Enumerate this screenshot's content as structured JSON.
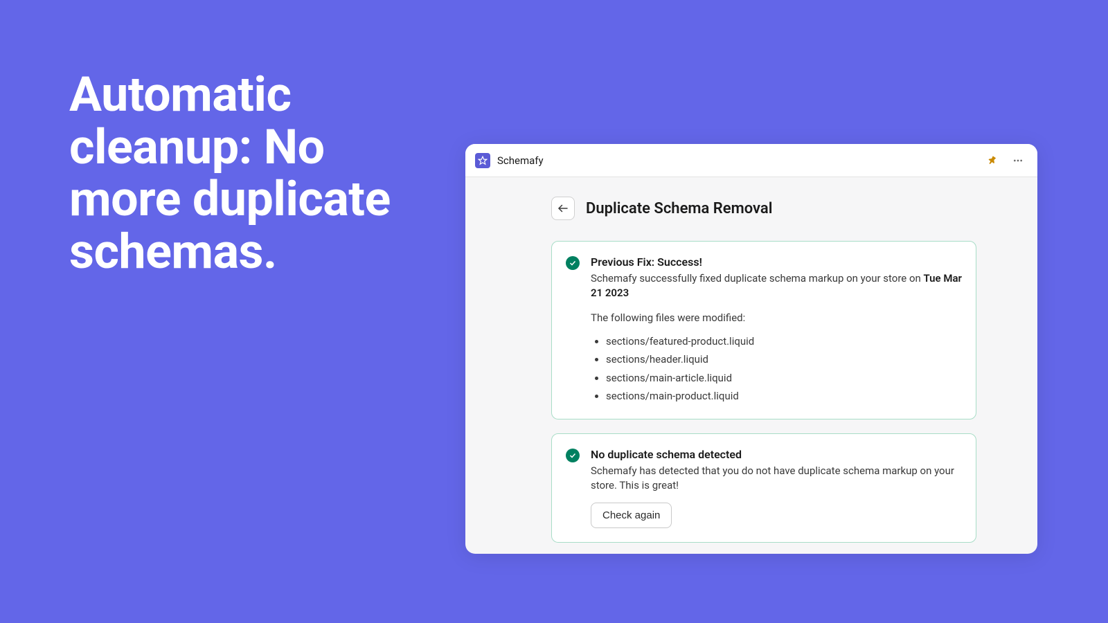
{
  "hero": {
    "headline": "Automatic cleanup: No more duplicate schemas."
  },
  "app": {
    "name": "Schemafy",
    "page_title": "Duplicate Schema Removal",
    "success_card": {
      "title": "Previous Fix: Success!",
      "desc_prefix": "Schemafy successfully fixed duplicate schema markup on your store on ",
      "desc_date": "Tue Mar 21 2023",
      "files_label": "The following files were modified:",
      "files": [
        "sections/featured-product.liquid",
        "sections/header.liquid",
        "sections/main-article.liquid",
        "sections/main-product.liquid"
      ]
    },
    "clean_card": {
      "title": "No duplicate schema detected",
      "desc": "Schemafy has detected that you do not have duplicate schema markup on your store. This is great!",
      "button_label": "Check again"
    }
  }
}
